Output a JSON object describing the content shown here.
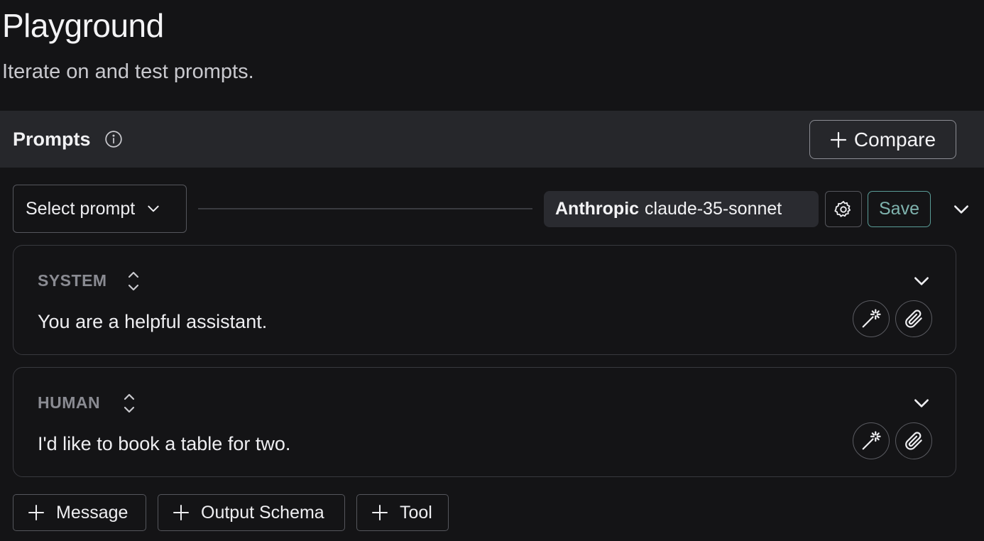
{
  "page": {
    "title": "Playground",
    "subtitle": "Iterate on and test prompts."
  },
  "prompts_bar": {
    "title": "Prompts",
    "info_icon": "info-circle-icon",
    "compare_label": "Compare"
  },
  "toolbar": {
    "select_prompt_label": "Select prompt",
    "model_provider": "Anthropic",
    "model_name": "claude-35-sonnet",
    "settings_icon": "gear-icon",
    "save_label": "Save"
  },
  "messages": [
    {
      "role": "SYSTEM",
      "text": "You are a helpful assistant."
    },
    {
      "role": "HUMAN",
      "text": "I'd like to book a table for two."
    }
  ],
  "add_buttons": {
    "message": "Message",
    "output_schema": "Output Schema",
    "tool": "Tool"
  },
  "colors": {
    "background": "#141416",
    "bar_background": "#26272b",
    "accent_save": "#7fb3ae",
    "muted_label": "#8a8b92"
  }
}
